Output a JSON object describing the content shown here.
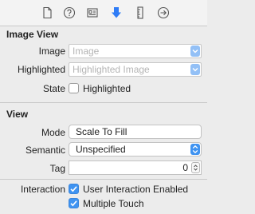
{
  "tabs": [
    {
      "icon": "file-icon"
    },
    {
      "icon": "help-icon"
    },
    {
      "icon": "identity-icon"
    },
    {
      "icon": "attributes-icon",
      "active": true
    },
    {
      "icon": "ruler-icon"
    },
    {
      "icon": "connections-icon"
    }
  ],
  "colors": {
    "accent": "#3f93f1",
    "active_tab": "#2f7cf6"
  },
  "image_view": {
    "title": "Image View",
    "image_label": "Image",
    "image_placeholder": "Image",
    "highlighted_label": "Highlighted",
    "highlighted_placeholder": "Highlighted Image",
    "state_label": "State",
    "state_checkbox_label": "Highlighted",
    "state_checked": false
  },
  "view": {
    "title": "View",
    "mode_label": "Mode",
    "mode_value": "Scale To Fill",
    "semantic_label": "Semantic",
    "semantic_value": "Unspecified",
    "tag_label": "Tag",
    "tag_value": "0",
    "interaction_label": "Interaction",
    "user_interaction_label": "User Interaction Enabled",
    "user_interaction_checked": true,
    "multiple_touch_label": "Multiple Touch",
    "multiple_touch_checked": true
  }
}
